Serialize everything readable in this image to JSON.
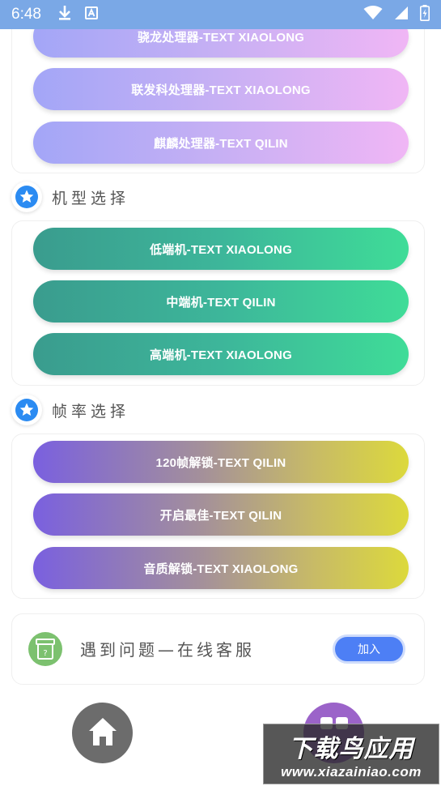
{
  "status_bar": {
    "time": "6:48",
    "icons": [
      "download-icon",
      "a-box-icon",
      "wifi-icon",
      "signal-icon",
      "battery-charging-icon"
    ]
  },
  "processor_section": {
    "buttons": [
      {
        "label": "骁龙处理器-TEXT XIAOLONG"
      },
      {
        "label": "联发科处理器-TEXT XIAOLONG"
      },
      {
        "label": "麒麟处理器-TEXT QILIN"
      }
    ]
  },
  "model_section": {
    "title": "机型选择",
    "icon": "star-icon",
    "buttons": [
      {
        "label": "低端机-TEXT XIAOLONG"
      },
      {
        "label": "中端机-TEXT QILIN"
      },
      {
        "label": "高端机-TEXT XIAOLONG"
      }
    ]
  },
  "framerate_section": {
    "title": "帧率选择",
    "icon": "star-icon",
    "buttons": [
      {
        "label": "120帧解锁-TEXT QILIN"
      },
      {
        "label": "开启最佳-TEXT QILIN"
      },
      {
        "label": "音质解锁-TEXT XIAOLONG"
      }
    ]
  },
  "support": {
    "text": "遇到问题—在线客服",
    "button_label": "加入",
    "icon": "help-box-icon"
  },
  "bottom_nav": {
    "home_icon": "home-icon",
    "other_icon": "apps-icon"
  },
  "watermark": {
    "title": "下载鸟应用",
    "url": "www.xiazainiao.com"
  },
  "colors": {
    "status_bar": "#7aa8e6",
    "join_button": "#4d7ff5",
    "support_icon": "#7cc16f",
    "home_button": "#6c6c6c",
    "other_button": "#9b63c9",
    "star_blue": "#2b8bf2"
  }
}
